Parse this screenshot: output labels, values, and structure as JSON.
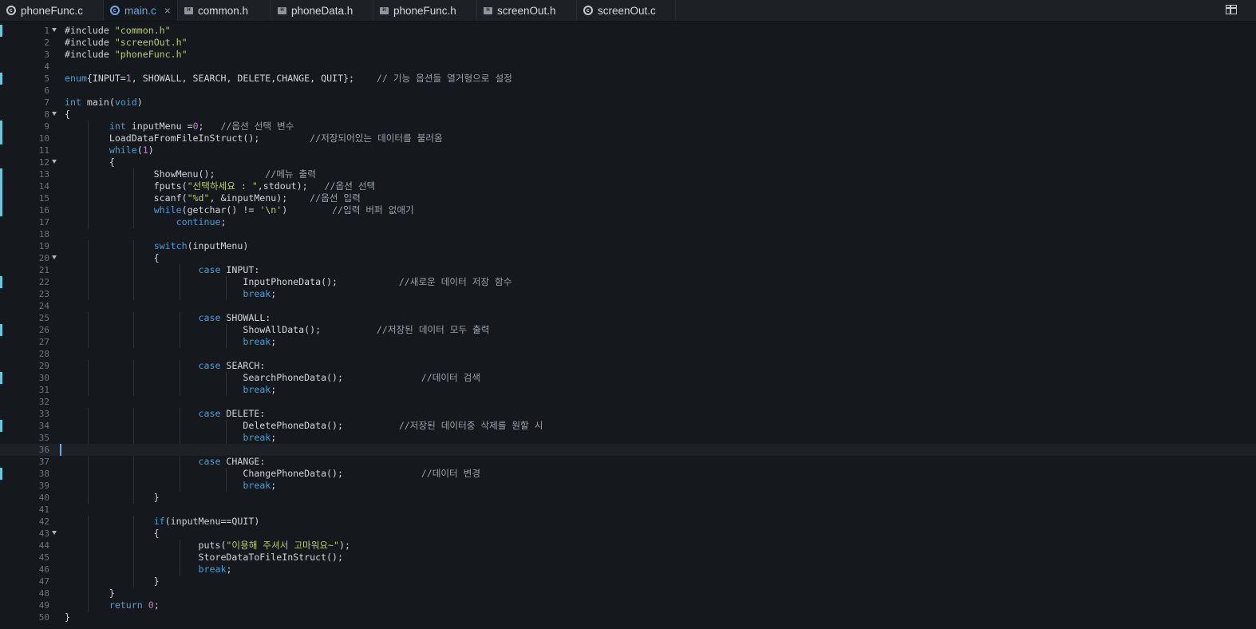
{
  "tabs": [
    {
      "label": "phoneFunc.c",
      "icon": "c-file-icon",
      "active": false
    },
    {
      "label": "main.c",
      "icon": "c-file-icon",
      "active": true
    },
    {
      "label": "common.h",
      "icon": "h-file-icon",
      "active": false
    },
    {
      "label": "phoneData.h",
      "icon": "h-file-icon",
      "active": false
    },
    {
      "label": "phoneFunc.h",
      "icon": "h-file-icon",
      "active": false
    },
    {
      "label": "screenOut.h",
      "icon": "h-file-icon",
      "active": false
    },
    {
      "label": "screenOut.c",
      "icon": "c-file-icon",
      "active": false
    }
  ],
  "close_glyph": "×",
  "header_glyph": "H",
  "fold_lines": [
    1,
    8,
    12,
    20,
    43
  ],
  "modified_lines": [
    1,
    5,
    9,
    10,
    13,
    14,
    15,
    16,
    22,
    26,
    30,
    34,
    38
  ],
  "current_line": 36,
  "lines": [
    "#include \"common.h\"",
    "#include \"screenOut.h\"",
    "#include \"phoneFunc.h\"",
    "",
    "enum{INPUT=1, SHOWALL, SEARCH, DELETE,CHANGE, QUIT};    // 기능 옵션들 열거형으로 설정",
    "",
    "int main(void)",
    "{",
    "        int inputMenu =0;   //옵션 선택 변수",
    "        LoadDataFromFileInStruct();         //저장되어있는 데이터를 불러옴",
    "        while(1)",
    "        {",
    "                ShowMenu();         //메뉴 출력",
    "                fputs(\"선택하세요 : \",stdout);   //옵션 선택",
    "                scanf(\"%d\", &inputMenu);    //옵션 입력",
    "                while(getchar() != '\\n')        //입력 버퍼 없애기",
    "                    continue;",
    "",
    "                switch(inputMenu)",
    "                {",
    "                        case INPUT:",
    "                                InputPhoneData();           //새로운 데이터 저장 함수",
    "                                break;",
    "",
    "                        case SHOWALL:",
    "                                ShowAllData();          //저장된 데이터 모두 출력",
    "                                break;",
    "",
    "                        case SEARCH:",
    "                                SearchPhoneData();              //데이터 검색",
    "                                break;",
    "",
    "                        case DELETE:",
    "                                DeletePhoneData();          //저장된 데이터중 삭제를 원할 시",
    "                                break;",
    "",
    "                        case CHANGE:",
    "                                ChangePhoneData();              //데이터 변경",
    "                                break;",
    "                }",
    "",
    "                if(inputMenu==QUIT)",
    "                {",
    "                        puts(\"이용해 주셔서 고마워요~\");",
    "                        StoreDataToFileInStruct();",
    "                        break;",
    "                }",
    "        }",
    "        return 0;",
    "}"
  ],
  "colors": {
    "background": "#15181c",
    "keyword": "#4b9ed6",
    "string": "#b7cf6a",
    "number": "#c27fd4",
    "comment": "#9aa3ab",
    "active_tab": "#6aa8e8",
    "modified_marker": "#69c7dc"
  }
}
